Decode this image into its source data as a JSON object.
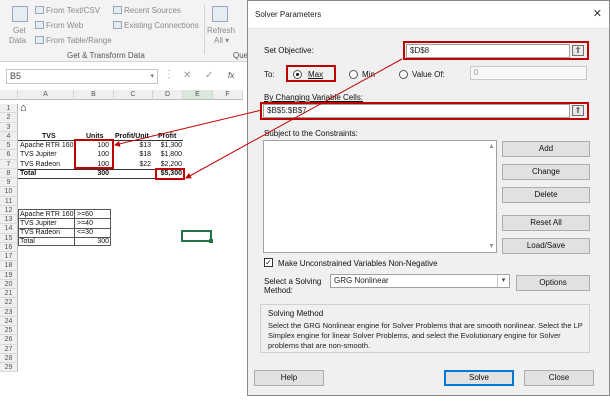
{
  "ribbon": {
    "get_data": "Get",
    "get_data2": "Data",
    "from_text": "From Text/CSV",
    "from_web": "From Web",
    "from_table": "From Table/Range",
    "recent_sources": "Recent Sources",
    "existing_connections": "Existing Connections",
    "refresh": "Refresh",
    "refresh_all": "All",
    "group_label": "Get & Transform Data",
    "queries_label": "Que"
  },
  "formula_bar": {
    "name_box": "B5",
    "fx": "fx"
  },
  "sheet": {
    "columns": [
      "A",
      "B",
      "C",
      "D",
      "E",
      "F"
    ],
    "rows": [
      "1",
      "2",
      "3",
      "4",
      "5",
      "6",
      "7",
      "8",
      "9",
      "10",
      "11",
      "12",
      "13",
      "14",
      "15",
      "16",
      "17",
      "18",
      "19",
      "20",
      "21",
      "22",
      "23",
      "24",
      "25",
      "26",
      "27",
      "28",
      "29"
    ],
    "headers": {
      "tvs": "TVS",
      "units": "Units",
      "profit_unit": "Profit/Unit",
      "profit": "Profit"
    },
    "products": [
      {
        "name": "Apache RTR 160",
        "units": "100",
        "profit_unit": "$13",
        "profit": "$1,300"
      },
      {
        "name": "TVS Jupiter",
        "units": "100",
        "profit_unit": "$18",
        "profit": "$1,800"
      },
      {
        "name": "TVS Radeon",
        "units": "100",
        "profit_unit": "$22",
        "profit": "$2,200"
      }
    ],
    "total": {
      "label": "Total",
      "units": "300",
      "profit": "$5,300"
    },
    "constraints": [
      {
        "name": "Apache RTR 160",
        "value": ">=60"
      },
      {
        "name": "TVS Jupiter",
        "value": ">=40"
      },
      {
        "name": "TVS Radeon",
        "value": "<=30"
      },
      {
        "name": "Total",
        "value": "300"
      }
    ]
  },
  "dialog": {
    "title": "Solver Parameters",
    "close": "✕",
    "set_objective_label": "Set Objective:",
    "set_objective_value": "$D$8",
    "to_label": "To:",
    "max_label": "Max",
    "min_label": "Min",
    "value_of_label": "Value Of:",
    "value_of_value": "0",
    "changing_cells_label": "By Changing Variable Cells:",
    "changing_cells_value": "$B$5:$B$7",
    "constraints_label": "Subject to the Constraints:",
    "add": "Add",
    "change": "Change",
    "delete": "Delete",
    "reset_all": "Reset All",
    "load_save": "Load/Save",
    "unconstrained_label": "Make Unconstrained Variables Non-Negative",
    "method_label_1": "Select a Solving",
    "method_label_2": "Method:",
    "method_value": "GRG Nonlinear",
    "options": "Options",
    "solving_method_title": "Solving Method",
    "solving_method_desc": "Select the GRG Nonlinear engine for Solver Problems that are smooth nonlinear. Select the LP Simplex engine for linear Solver Problems, and select the Evolutionary engine for Solver problems that are non-smooth.",
    "help": "Help",
    "solve": "Solve",
    "close_btn": "Close"
  },
  "colors": {
    "highlight": "#c00000",
    "selection": "#217346",
    "button_focus": "#0078d7"
  }
}
